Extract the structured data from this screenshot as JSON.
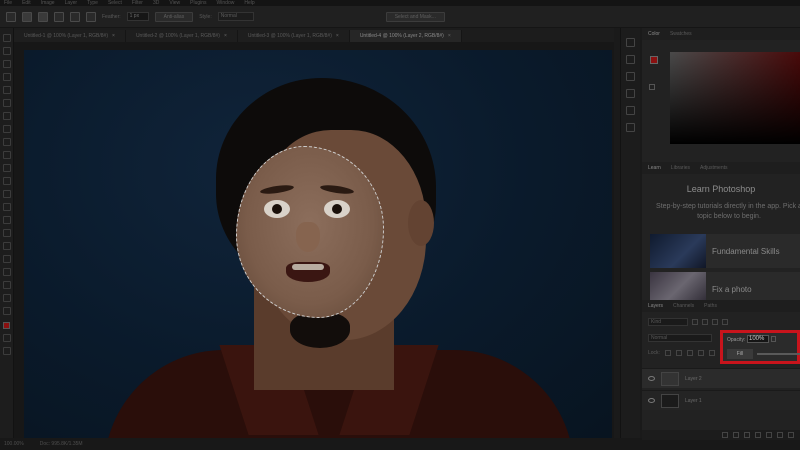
{
  "menubar": {
    "items": [
      "File",
      "Edit",
      "Image",
      "Layer",
      "Type",
      "Select",
      "Filter",
      "3D",
      "View",
      "Plugins",
      "Window",
      "Help"
    ]
  },
  "options": {
    "feather_label": "Feather:",
    "feather_value": "1 px",
    "antialias_label": "Anti-alias",
    "style_label": "Style:",
    "style_value": "Normal",
    "select_mask_label": "Select and Mask..."
  },
  "tabs": [
    {
      "label": "Untitled-1 @ 100% (Layer 1, RGB/8#)",
      "active": false
    },
    {
      "label": "Untitled-2 @ 100% (Layer 1, RGB/8#)",
      "active": false
    },
    {
      "label": "Untitled-3 @ 100% (Layer 1, RGB/8#)",
      "active": false
    },
    {
      "label": "Untitled-4 @ 100% (Layer 2, RGB/8#)",
      "active": true
    }
  ],
  "status": {
    "zoom": "100.00%",
    "doc": "Doc: 995.8K/1.35M"
  },
  "color_panel": {
    "tabs": [
      "Color",
      "Swatches"
    ],
    "fg_color": "#8a1010"
  },
  "learn_panel": {
    "tabs": [
      "Learn",
      "Libraries",
      "Adjustments"
    ],
    "title": "Learn Photoshop",
    "description": "Step-by-step tutorials directly in the app. Pick a topic below to begin.",
    "cards": [
      "Fundamental Skills",
      "Fix a photo"
    ]
  },
  "layers_panel": {
    "tabs": [
      "Layers",
      "Channels",
      "Paths"
    ],
    "kind_label": "Kind",
    "blend_mode": "Normal",
    "lock_label": "Lock:",
    "opacity_label": "Opacity:",
    "opacity_value": "100%",
    "fill_label": "Fill",
    "layers": [
      {
        "name": "Layer 2",
        "visible": true
      },
      {
        "name": "Layer 1",
        "visible": true
      }
    ]
  },
  "highlight_color": "#c8141c"
}
